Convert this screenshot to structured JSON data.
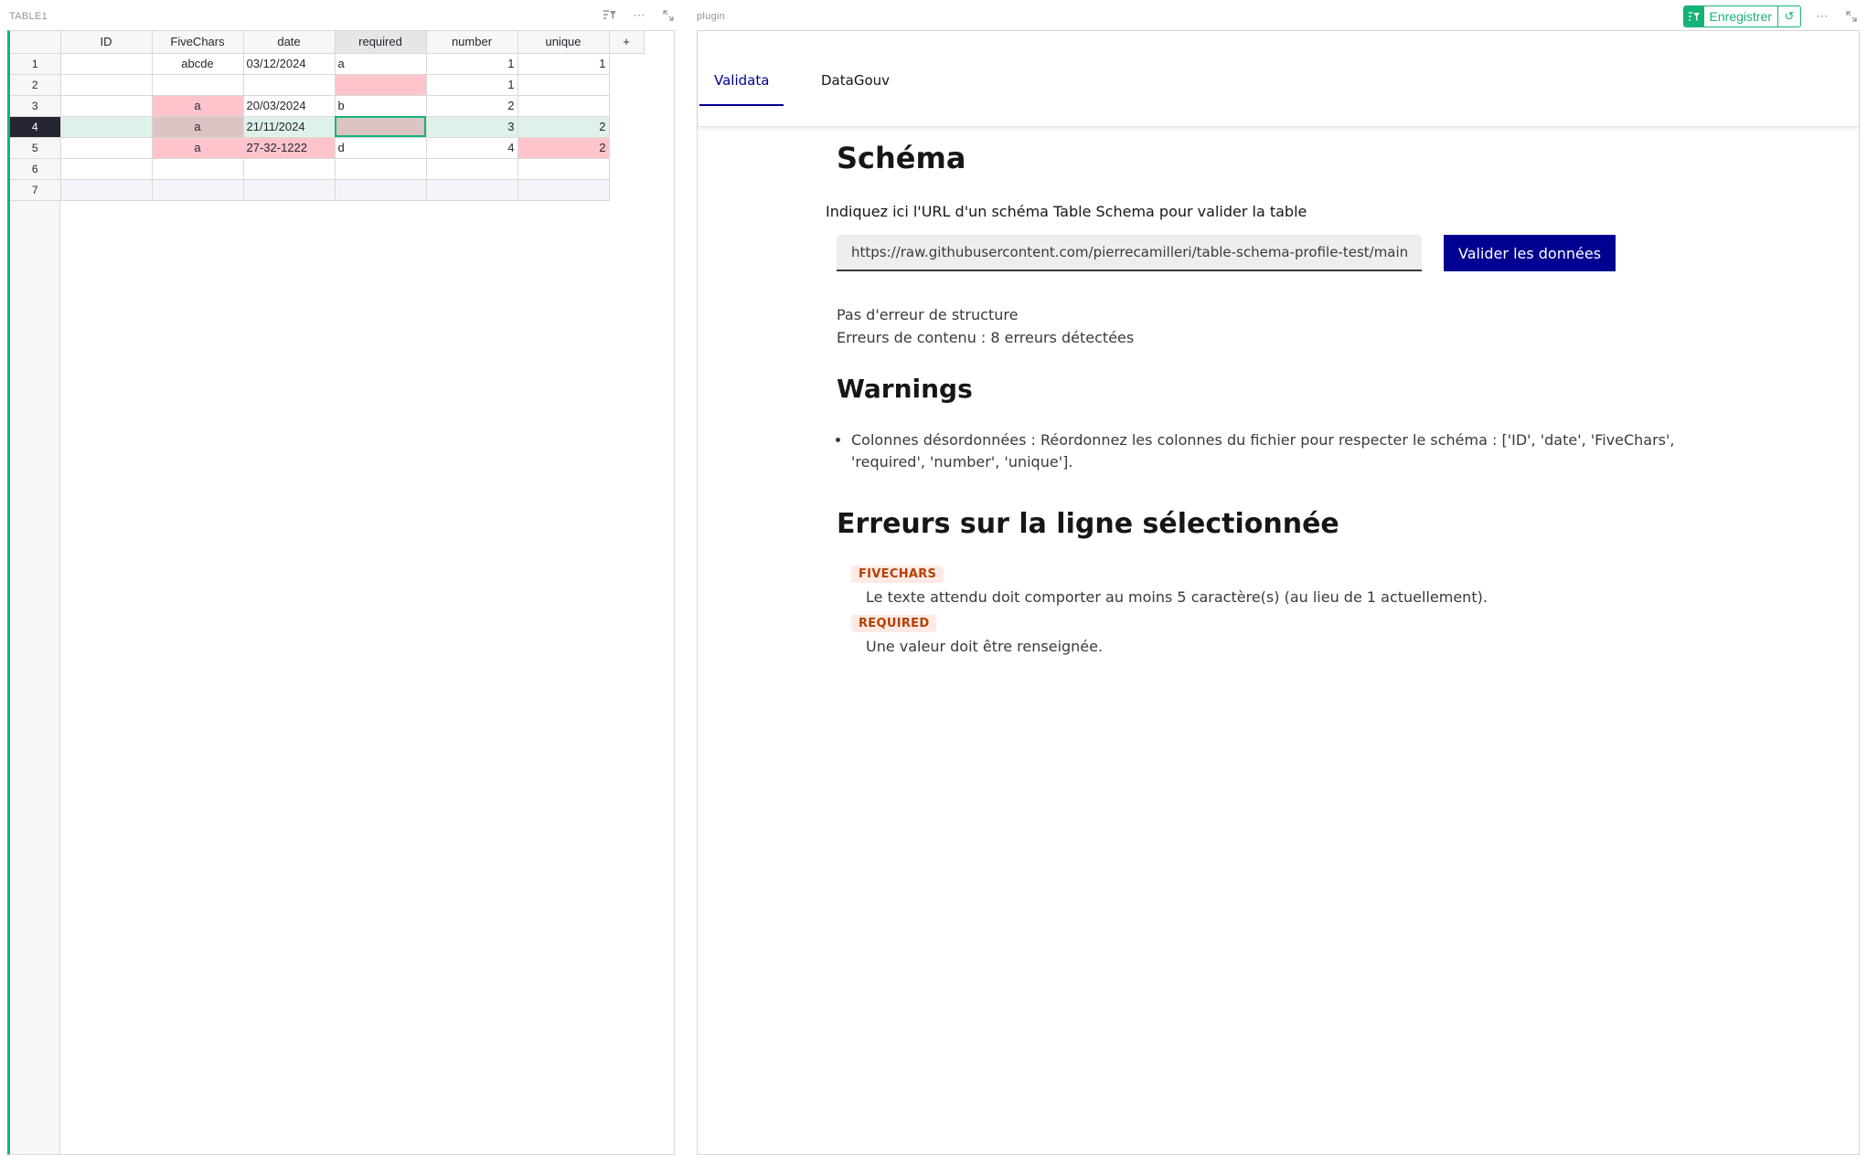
{
  "left_widget": {
    "title": "TABLE1"
  },
  "table": {
    "columns": [
      "ID",
      "FiveChars",
      "date",
      "required",
      "number",
      "unique"
    ],
    "add_column_label": "+",
    "rows": [
      {
        "num": "1",
        "ID": "",
        "FiveChars": "abcde",
        "date": "03/12/2024",
        "required": "a",
        "number": "1",
        "unique": "1"
      },
      {
        "num": "2",
        "ID": "",
        "FiveChars": "",
        "date": "",
        "required": "",
        "number": "1",
        "unique": ""
      },
      {
        "num": "3",
        "ID": "",
        "FiveChars": "a",
        "date": "20/03/2024",
        "required": "b",
        "number": "2",
        "unique": ""
      },
      {
        "num": "4",
        "ID": "",
        "FiveChars": "a",
        "date": "21/11/2024",
        "required": "",
        "number": "3",
        "unique": "2"
      },
      {
        "num": "5",
        "ID": "",
        "FiveChars": "a",
        "date": "27-32-1222",
        "required": "d",
        "number": "4",
        "unique": "2"
      },
      {
        "num": "6",
        "ID": "",
        "FiveChars": "",
        "date": "",
        "required": "",
        "number": "",
        "unique": ""
      },
      {
        "num": "7",
        "ID": "",
        "FiveChars": "",
        "date": "",
        "required": "",
        "number": "",
        "unique": ""
      }
    ]
  },
  "right_widget": {
    "title": "plugin",
    "save_label": "Enregistrer"
  },
  "plugin": {
    "tabs": [
      {
        "label": "Validata",
        "active": true
      },
      {
        "label": "DataGouv",
        "active": false
      }
    ],
    "schema_heading": "Schéma",
    "instruction": "Indiquez ici l'URL d'un schéma Table Schema pour valider la table",
    "url_value": "https://raw.githubusercontent.com/pierrecamilleri/table-schema-profile-test/main/schema.json",
    "validate_button": "Valider les données",
    "status_structure": "Pas d'erreur de structure",
    "status_content": "Erreurs de contenu : 8 erreurs détectées",
    "warnings_heading": "Warnings",
    "warnings": [
      "Colonnes désordonnées : Réordonnez les colonnes du fichier pour respecter le schéma : ['ID', 'date', 'FiveChars', 'required', 'number', 'unique']."
    ],
    "errors_heading": "Erreurs sur la ligne sélectionnée",
    "errors": [
      {
        "field": "FIVECHARS",
        "message": "Le texte attendu doit comporter au moins 5 caractère(s) (au lieu de 1 actuellement)."
      },
      {
        "field": "REQUIRED",
        "message": "Une valeur doit être renseignée."
      }
    ]
  },
  "colors": {
    "accent_green": "#16b378",
    "error_cell": "#fdc4cc",
    "dsfr_blue": "#000091",
    "badge_bg": "#fee9e5",
    "badge_text": "#b34000"
  }
}
